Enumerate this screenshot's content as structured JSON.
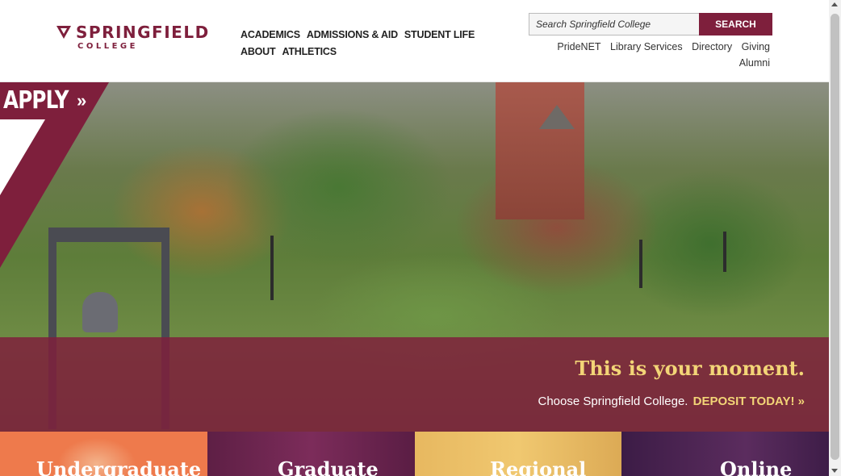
{
  "header": {
    "logo": {
      "title": "SPRINGFIELD",
      "subtitle": "COLLEGE"
    },
    "main_nav": [
      {
        "label": "ACADEMICS"
      },
      {
        "label": "ADMISSIONS & AID"
      },
      {
        "label": "STUDENT LIFE"
      },
      {
        "label": "ABOUT"
      },
      {
        "label": "ATHLETICS"
      }
    ],
    "search": {
      "placeholder": "Search Springfield College",
      "button_label": "SEARCH"
    },
    "utility_nav": [
      {
        "label": "PrideNET"
      },
      {
        "label": "Library Services"
      },
      {
        "label": "Directory"
      },
      {
        "label": "Giving"
      },
      {
        "label": "Alumni"
      }
    ]
  },
  "hero": {
    "apply_label": "APPLY",
    "apply_arrows": "»",
    "headline": "This is your moment.",
    "tagline": "Choose Springfield College.",
    "cta_label": "DEPOSIT TODAY!",
    "cta_arrows": "»"
  },
  "tiles": [
    {
      "label": "Undergraduate"
    },
    {
      "label": "Graduate"
    },
    {
      "label": "Regional"
    },
    {
      "label": "Online"
    }
  ],
  "colors": {
    "brand": "#7e1f3c",
    "accent": "#f3d577"
  }
}
